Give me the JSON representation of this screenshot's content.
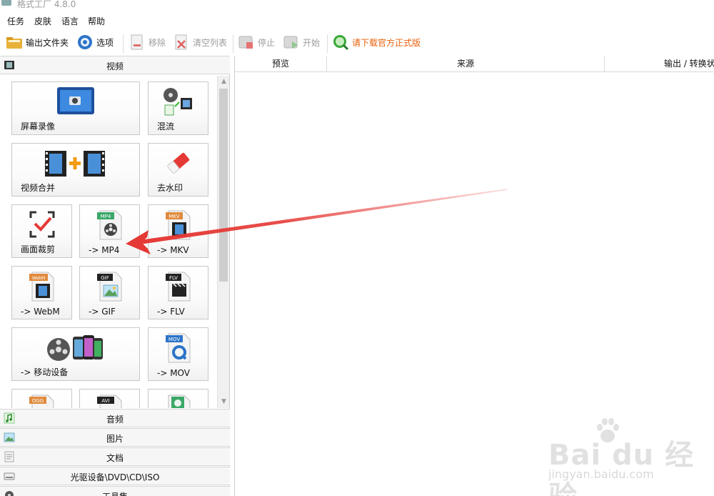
{
  "window": {
    "title": "格式工厂 4.8.0"
  },
  "menu": [
    "任务",
    "皮肤",
    "语言",
    "帮助"
  ],
  "toolbar": {
    "output_folder": "输出文件夹",
    "options": "选项",
    "remove": "移除",
    "clear_list": "清空列表",
    "stop": "停止",
    "start": "开始",
    "download_official": "请下载官方正式版"
  },
  "left": {
    "video_header": "视频",
    "tiles": {
      "screen_record": "屏幕录像",
      "mux": "混流",
      "video_merge": "视频合并",
      "remove_watermark": "去水印",
      "crop": "画面裁剪",
      "mp4": "-> MP4",
      "mkv": "-> MKV",
      "webm": "-> WebM",
      "gif": "-> GIF",
      "flv": "-> FLV",
      "mobile": "-> 移动设备",
      "mov": "-> MOV"
    },
    "icon_badges": {
      "mp4": "MP4",
      "mkv": "MKV",
      "webm": "WebM",
      "gif": "GIF",
      "flv": "FLV",
      "mov": "MOV",
      "avi": "AVI",
      "ogg": "OGG"
    },
    "sections": [
      "音频",
      "图片",
      "文档",
      "光驱设备\\DVD\\CD\\ISO",
      "工具集"
    ]
  },
  "table": {
    "columns": [
      "预览",
      "来源",
      "输出 / 转换状"
    ]
  },
  "watermark": {
    "brand": "Bai du 经验",
    "url": "jingyan.baidu.com"
  },
  "colors": {
    "promo": "#e8600a",
    "annotation_arrow": "#e53935"
  }
}
